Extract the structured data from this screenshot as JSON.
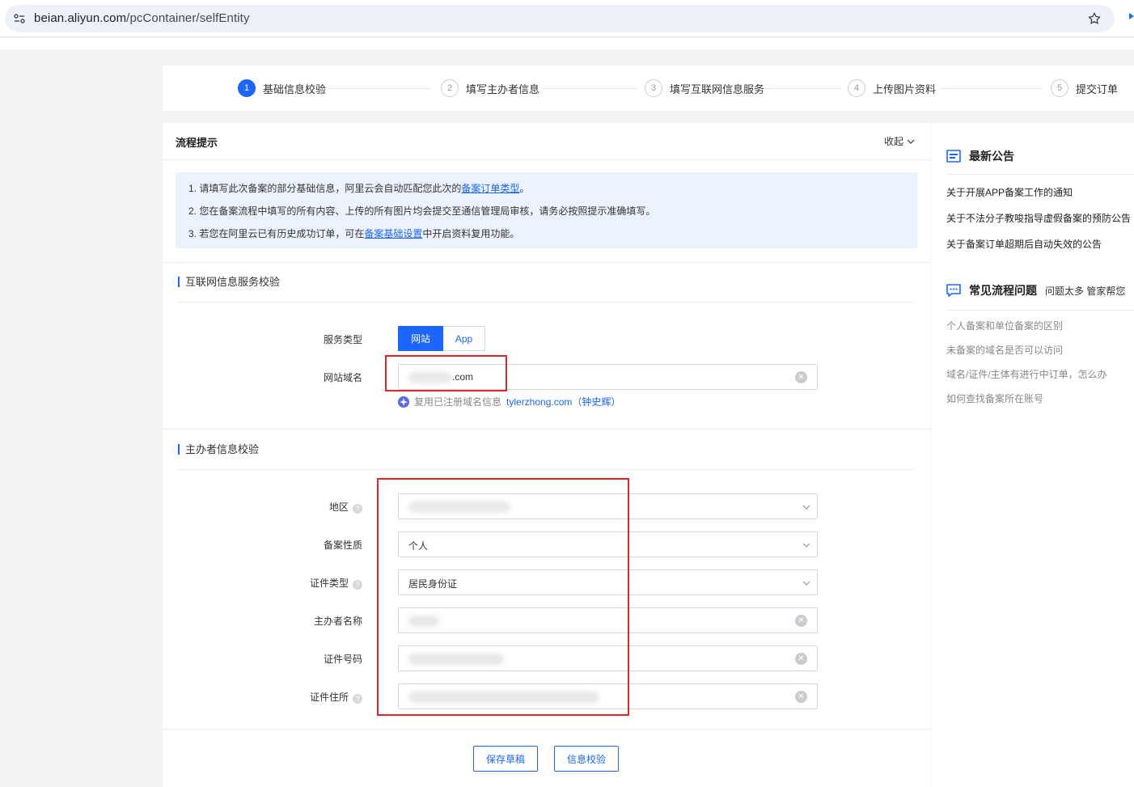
{
  "browser": {
    "url_host": "beian.aliyun.com",
    "url_path": "/pcContainer/selfEntity"
  },
  "steps": [
    {
      "num": "1",
      "label": "基础信息校验",
      "active": true
    },
    {
      "num": "2",
      "label": "填写主办者信息",
      "active": false
    },
    {
      "num": "3",
      "label": "填写互联网信息服务",
      "active": false
    },
    {
      "num": "4",
      "label": "上传图片资料",
      "active": false
    },
    {
      "num": "5",
      "label": "提交订单",
      "active": false
    }
  ],
  "process_tips": {
    "title": "流程提示",
    "collapse_label": "收起",
    "lines": [
      {
        "before": "1. 请填写此次备案的部分基础信息，阿里云会自动匹配您此次的",
        "link": "备案订单类型",
        "after": "。"
      },
      {
        "before": "2. 您在备案流程中填写的所有内容、上传的所有图片均会提交至通信管理局审核，请务必按照提示准确填写。",
        "link": "",
        "after": ""
      },
      {
        "before": "3. 若您在阿里云已有历史成功订单，可在",
        "link": "备案基础设置",
        "after": "中开启资料复用功能。"
      }
    ]
  },
  "internet_section": {
    "title": "互联网信息服务校验",
    "service_type_label": "服务类型",
    "service_type_options": [
      "网站",
      "App"
    ],
    "service_type_selected": "网站",
    "domain_label": "网站域名",
    "domain_value_suffix": ".com",
    "reuse_hint": "复用已注册域名信息",
    "reuse_link": "tylerzhong.com（钟史辉）"
  },
  "sponsor_section": {
    "title": "主办者信息校验",
    "fields": [
      {
        "label": "地区",
        "value": "",
        "help": true,
        "kind": "select"
      },
      {
        "label": "备案性质",
        "value": "个人",
        "help": false,
        "kind": "select"
      },
      {
        "label": "证件类型",
        "value": "居民身份证",
        "help": true,
        "kind": "select"
      },
      {
        "label": "主办者名称",
        "value": "",
        "help": false,
        "kind": "input"
      },
      {
        "label": "证件号码",
        "value": "",
        "help": false,
        "kind": "input"
      },
      {
        "label": "证件住所",
        "value": "",
        "help": true,
        "kind": "input"
      }
    ]
  },
  "actions": {
    "save_draft": "保存草稿",
    "verify": "信息校验"
  },
  "sidebar": {
    "announcements_title": "最新公告",
    "announcements": [
      "关于开展APP备案工作的通知",
      "关于不法分子教唆指导虚假备案的预防公告",
      "关于备案订单超期后自动失效的公告"
    ],
    "faq_title": "常见流程问题",
    "faq_subtitle": "问题太多 管家帮您",
    "faqs": [
      "个人备案和单位备案的区别",
      "未备案的域名是否可以访问",
      "域名/证件/主体有进行中订单，怎么办",
      "如何查找备案所在账号"
    ]
  },
  "colors": {
    "accent": "#1a66ff",
    "annotation_red": "#e0262a",
    "notice_bg": "#ecf3fe"
  }
}
